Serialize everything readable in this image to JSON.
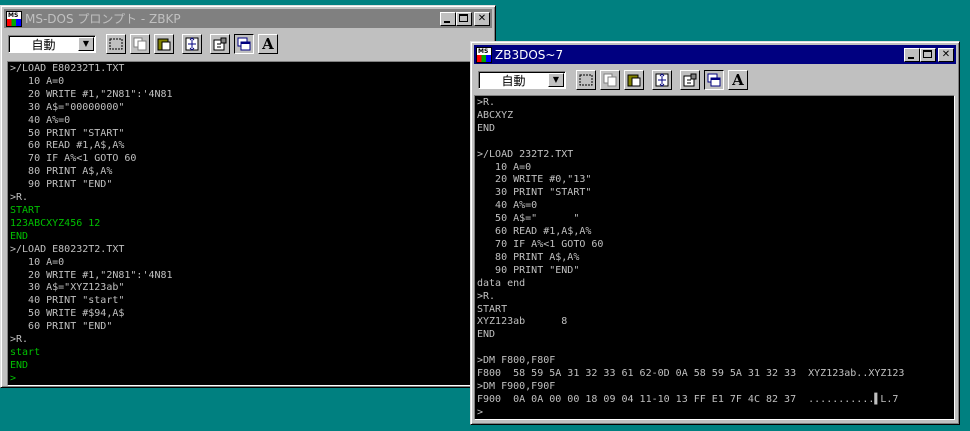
{
  "colors": {
    "desktop": "#008080",
    "console_bg": "#000000",
    "console_text": "#c0c0c0",
    "console_green": "#00c000",
    "active_title": "#000080",
    "inactive_title": "#808080"
  },
  "window1": {
    "title": "MS-DOS プロンプト - ZBKP",
    "font_select": "自動",
    "lines": [
      {
        "t": ">/LOAD E80232T1.TXT",
        "c": "w"
      },
      {
        "t": "   10 A=0",
        "c": "w"
      },
      {
        "t": "   20 WRITE #1,\"2N81\":'4N81",
        "c": "w"
      },
      {
        "t": "   30 A$=\"00000000\"",
        "c": "w"
      },
      {
        "t": "   40 A%=0",
        "c": "w"
      },
      {
        "t": "   50 PRINT \"START\"",
        "c": "w"
      },
      {
        "t": "   60 READ #1,A$,A%",
        "c": "w"
      },
      {
        "t": "   70 IF A%<1 GOTO 60",
        "c": "w"
      },
      {
        "t": "   80 PRINT A$,A%",
        "c": "w"
      },
      {
        "t": "   90 PRINT \"END\"",
        "c": "w"
      },
      {
        "t": ">R.",
        "c": "w"
      },
      {
        "t": "START",
        "c": "g"
      },
      {
        "t": "123ABCXYZ456 12",
        "c": "g"
      },
      {
        "t": "END",
        "c": "g"
      },
      {
        "t": ">/LOAD E80232T2.TXT",
        "c": "w"
      },
      {
        "t": "   10 A=0",
        "c": "w"
      },
      {
        "t": "   20 WRITE #1,\"2N81\":'4N81",
        "c": "w"
      },
      {
        "t": "   30 A$=\"XYZ123ab\"",
        "c": "w"
      },
      {
        "t": "   40 PRINT \"start\"",
        "c": "w"
      },
      {
        "t": "   50 WRITE #$94,A$",
        "c": "w"
      },
      {
        "t": "   60 PRINT \"END\"",
        "c": "w"
      },
      {
        "t": ">R.",
        "c": "w"
      },
      {
        "t": "start",
        "c": "g"
      },
      {
        "t": "END",
        "c": "g"
      },
      {
        "t": ">",
        "c": "g"
      }
    ]
  },
  "window2": {
    "title": "ZB3DOS~7",
    "font_select": "自動",
    "lines": [
      {
        "t": ">R.",
        "c": "w"
      },
      {
        "t": "ABCXYZ",
        "c": "w"
      },
      {
        "t": "END",
        "c": "w"
      },
      {
        "t": "",
        "c": "w"
      },
      {
        "t": ">/LOAD 232T2.TXT",
        "c": "w"
      },
      {
        "t": "   10 A=0",
        "c": "w"
      },
      {
        "t": "   20 WRITE #0,\"13\"",
        "c": "w"
      },
      {
        "t": "   30 PRINT \"START\"",
        "c": "w"
      },
      {
        "t": "   40 A%=0",
        "c": "w"
      },
      {
        "t": "   50 A$=\"      \"",
        "c": "w"
      },
      {
        "t": "   60 READ #1,A$,A%",
        "c": "w"
      },
      {
        "t": "   70 IF A%<1 GOTO 60",
        "c": "w"
      },
      {
        "t": "   80 PRINT A$,A%",
        "c": "w"
      },
      {
        "t": "   90 PRINT \"END\"",
        "c": "w"
      },
      {
        "t": "data end",
        "c": "w"
      },
      {
        "t": ">R.",
        "c": "w"
      },
      {
        "t": "START",
        "c": "w"
      },
      {
        "t": "XYZ123ab      8",
        "c": "w"
      },
      {
        "t": "END",
        "c": "w"
      },
      {
        "t": "",
        "c": "w"
      },
      {
        "t": ">DM F800,F80F",
        "c": "w"
      },
      {
        "t": "F800  58 59 5A 31 32 33 61 62-0D 0A 58 59 5A 31 32 33  XYZ123ab..XYZ123",
        "c": "w"
      },
      {
        "t": ">DM F900,F90F",
        "c": "w"
      },
      {
        "t": "F900  0A 0A 00 00 18 09 04 11-10 13 FF E1 7F 4C 82 37  ...........▌L.7",
        "c": "w"
      },
      {
        "t": ">",
        "c": "w"
      }
    ]
  }
}
